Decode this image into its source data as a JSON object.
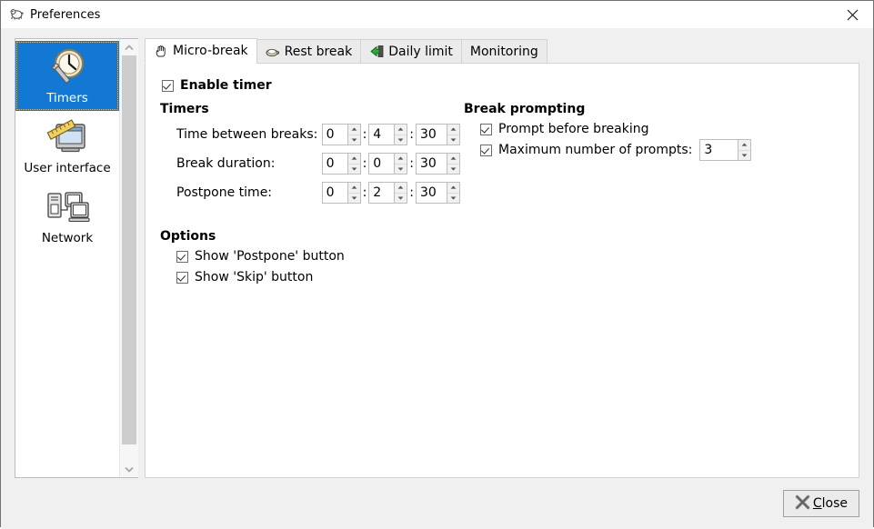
{
  "window": {
    "title": "Preferences",
    "icon": "preferences-window-icon",
    "close_icon": "window-close-icon"
  },
  "sidebar": {
    "items": [
      {
        "label": "Timers",
        "icon": "clock-wrench-icon",
        "selected": true
      },
      {
        "label": "User interface",
        "icon": "monitor-ruler-icon",
        "selected": false
      },
      {
        "label": "Network",
        "icon": "network-computers-icon",
        "selected": false
      }
    ],
    "scrollbar": {
      "up_icon": "chevron-up-icon",
      "down_icon": "chevron-down-icon"
    }
  },
  "tabs": [
    {
      "label": "Micro-break",
      "icon": "hand-icon",
      "active": true
    },
    {
      "label": "Rest break",
      "icon": "coffee-cup-icon",
      "active": false
    },
    {
      "label": "Daily limit",
      "icon": "green-exit-arrow-icon",
      "active": false
    },
    {
      "label": "Monitoring",
      "icon": "",
      "active": false
    }
  ],
  "panel": {
    "enable_timer": {
      "label": "Enable timer",
      "checked": true
    },
    "timers": {
      "title": "Timers",
      "rows": [
        {
          "label": "Time between breaks:",
          "hours": "0",
          "minutes": "4",
          "seconds": "30"
        },
        {
          "label": "Break duration:",
          "hours": "0",
          "minutes": "0",
          "seconds": "30"
        },
        {
          "label": "Postpone time:",
          "hours": "0",
          "minutes": "2",
          "seconds": "30"
        }
      ],
      "separator": ":"
    },
    "options": {
      "title": "Options",
      "items": [
        {
          "label": "Show 'Postpone' button",
          "checked": true
        },
        {
          "label": "Show 'Skip' button",
          "checked": true
        }
      ]
    },
    "break_prompting": {
      "title": "Break prompting",
      "prompt_before_breaking": {
        "label": "Prompt before breaking",
        "checked": true
      },
      "max_prompts": {
        "label": "Maximum number of prompts:",
        "checked": true,
        "value": "3"
      }
    }
  },
  "footer": {
    "close": {
      "label_prefix": "",
      "label_mnemonic": "C",
      "label_rest": "lose",
      "icon": "close-x-icon"
    }
  },
  "colors": {
    "selection_blue": "#1378d4",
    "window_bg": "#f0f0f0",
    "panel_bg": "#ffffff",
    "tab_inactive_bg": "#ebebeb"
  }
}
